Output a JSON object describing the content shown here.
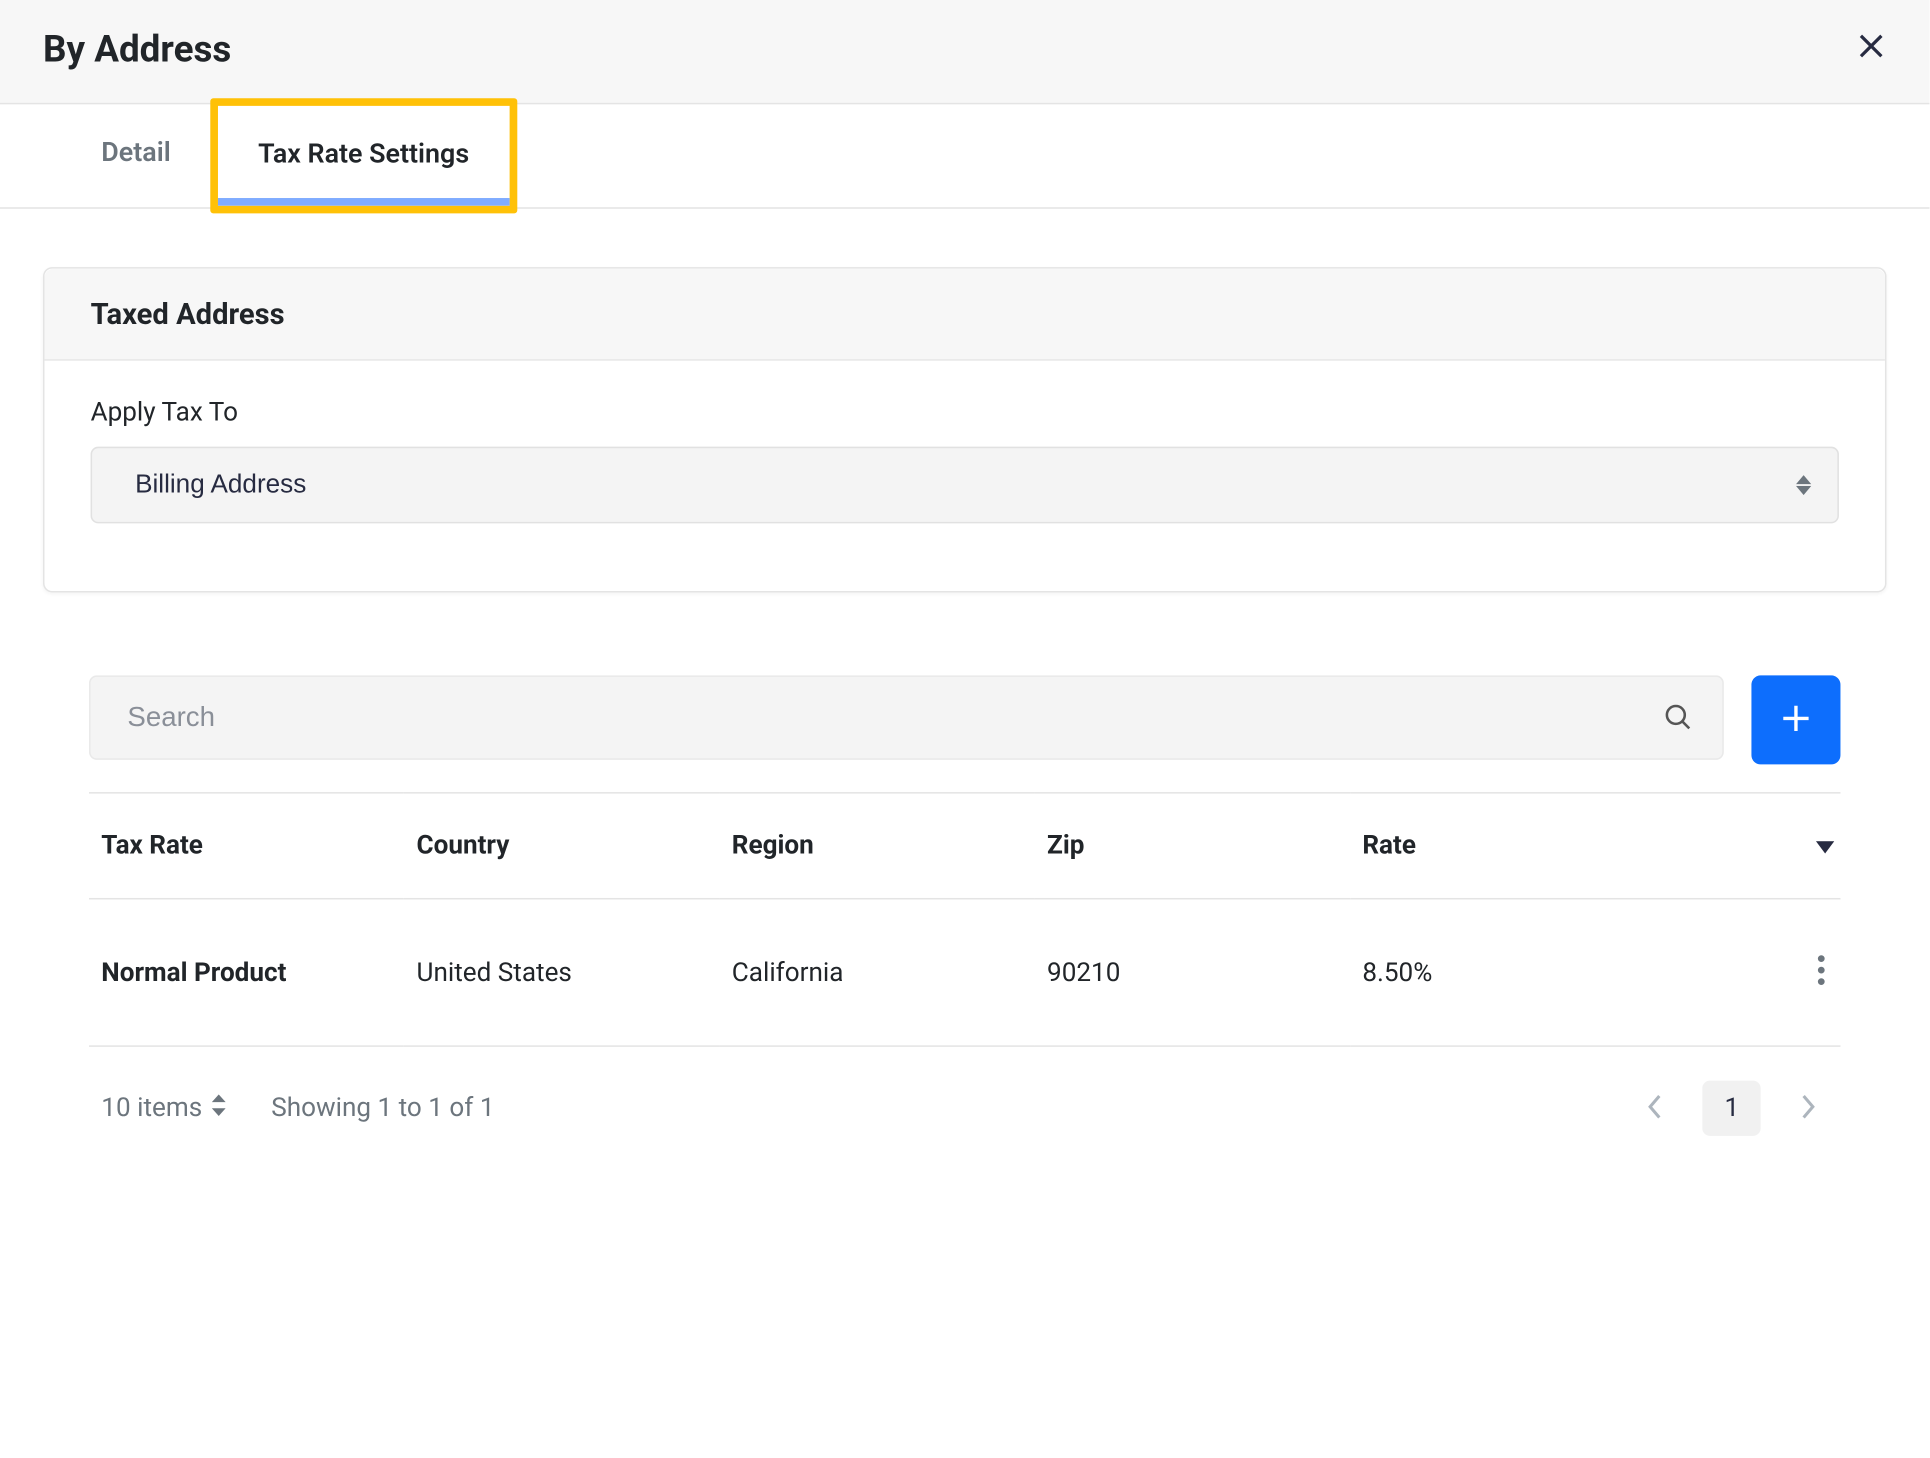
{
  "header": {
    "title": "By Address"
  },
  "tabs": {
    "detail": "Detail",
    "tax_rate_settings": "Tax Rate Settings"
  },
  "card": {
    "title": "Taxed Address",
    "apply_tax_to_label": "Apply Tax To",
    "apply_tax_to_value": "Billing Address"
  },
  "list": {
    "search_placeholder": "Search",
    "columns": {
      "tax_rate": "Tax Rate",
      "country": "Country",
      "region": "Region",
      "zip": "Zip",
      "rate": "Rate"
    },
    "rows": [
      {
        "tax_rate": "Normal Product",
        "country": "United States",
        "region": "California",
        "zip": "90210",
        "rate": "8.50%"
      }
    ],
    "footer": {
      "page_size_label": "10 items",
      "showing": "Showing 1 to 1 of 1",
      "current_page": "1"
    }
  }
}
